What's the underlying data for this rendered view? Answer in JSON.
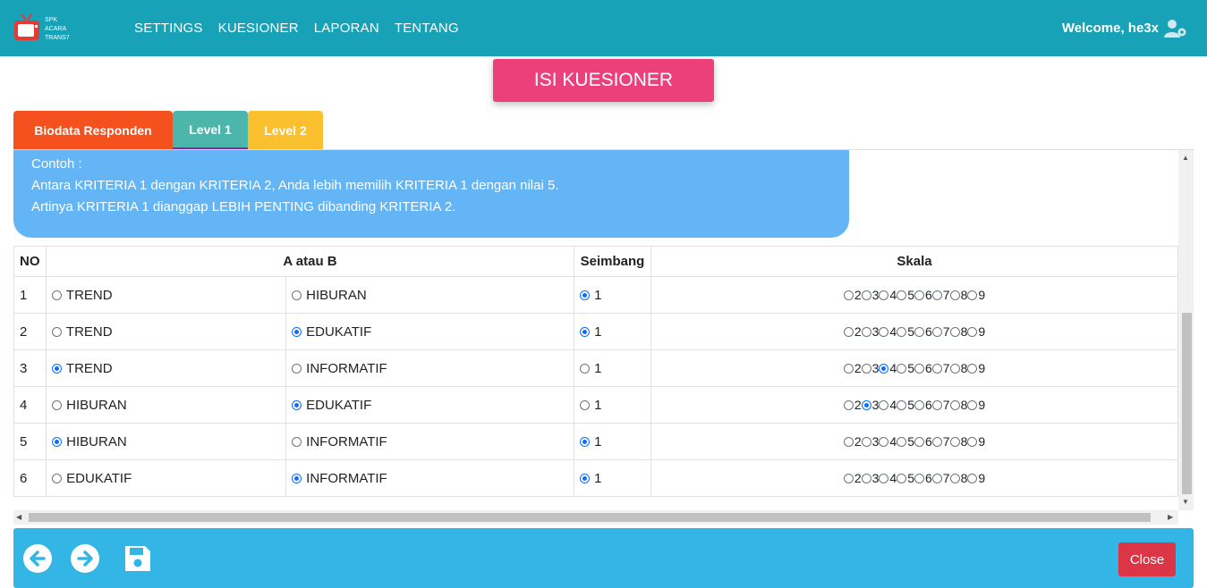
{
  "nav": {
    "logo_text": [
      "SPK",
      "ACARA",
      "TRANS7"
    ],
    "links": [
      "SETTINGS",
      "KUESIONER",
      "LAPORAN",
      "TENTANG"
    ],
    "welcome": "Welcome, he3x"
  },
  "title": "ISI KUESIONER",
  "tabs": [
    "Biodata Responden",
    "Level 1",
    "Level 2"
  ],
  "info": {
    "lines": [
      "Contoh :",
      "Antara KRITERIA 1 dengan KRITERIA 2, Anda lebih memilih KRITERIA 1 dengan nilai 5.",
      "Artinya KRITERIA 1 dianggap LEBIH PENTING dibanding KRITERIA 2."
    ]
  },
  "table": {
    "headers": [
      "NO",
      "A atau B",
      "Seimbang",
      "Skala"
    ],
    "seimbang_value": "1",
    "scale_values": [
      "2",
      "3",
      "4",
      "5",
      "6",
      "7",
      "8",
      "9"
    ],
    "rows": [
      {
        "no": "1",
        "a": "TREND",
        "b": "HIBURAN",
        "selected": "seimbang",
        "scale": null
      },
      {
        "no": "2",
        "a": "TREND",
        "b": "EDUKATIF",
        "selected": "b",
        "scale": null,
        "seimbang": true
      },
      {
        "no": "3",
        "a": "TREND",
        "b": "INFORMATIF",
        "selected": "a",
        "scale": "4"
      },
      {
        "no": "4",
        "a": "HIBURAN",
        "b": "EDUKATIF",
        "selected": "b",
        "scale": "3"
      },
      {
        "no": "5",
        "a": "HIBURAN",
        "b": "INFORMATIF",
        "selected": "a",
        "scale": null,
        "seimbang": true
      },
      {
        "no": "6",
        "a": "EDUKATIF",
        "b": "INFORMATIF",
        "selected": "b",
        "scale": null,
        "seimbang": true
      }
    ]
  },
  "footer": {
    "close_label": "Close"
  },
  "colors": {
    "navbar": "#17a2b8",
    "title_button": "#ec407a",
    "tab_biodata": "#f4511e",
    "tab_level1": "#4db6ac",
    "tab_level2": "#fbc02d",
    "info_box": "#64b5f6",
    "footer": "#33b5e5",
    "close_button": "#dc3545"
  },
  "icons": [
    "tv-logo-icon",
    "user-cog-icon",
    "arrow-left-icon",
    "arrow-right-icon",
    "save-icon"
  ]
}
